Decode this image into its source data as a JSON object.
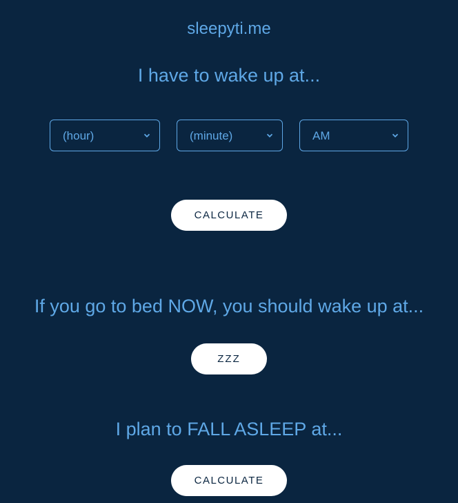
{
  "title": "sleepyti.me",
  "wake": {
    "heading": "I have to wake up at...",
    "hour_placeholder": "(hour)",
    "minute_placeholder": "(minute)",
    "ampm_selected": "AM",
    "calculate_label": "CALCULATE"
  },
  "bed_now": {
    "heading": "If you go to bed NOW, you should wake up at...",
    "zzz_label": "ZZZ"
  },
  "asleep": {
    "heading": "I plan to FALL ASLEEP at...",
    "calculate_label": "CALCULATE"
  }
}
